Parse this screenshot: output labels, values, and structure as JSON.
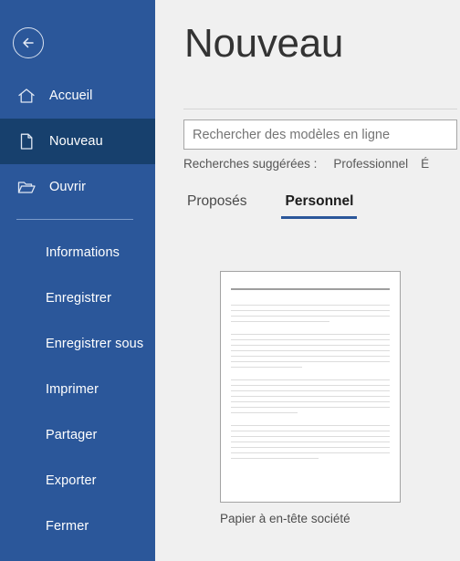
{
  "window": {
    "app": "Word",
    "accent_color": "#2b579a",
    "selected_color": "#17406d",
    "background_color": "#f0f0f0"
  },
  "sidebar": {
    "back_button": {
      "icon": "back-arrow-circle-icon",
      "label": "Retour"
    },
    "primary_items": [
      {
        "label": "Accueil",
        "icon": "home-icon",
        "selected": false
      },
      {
        "label": "Nouveau",
        "icon": "new-document-icon",
        "selected": true
      },
      {
        "label": "Ouvrir",
        "icon": "open-folder-icon",
        "selected": false
      }
    ],
    "secondary_items": [
      {
        "label": "Informations"
      },
      {
        "label": "Enregistrer"
      },
      {
        "label": "Enregistrer sous"
      },
      {
        "label": "Imprimer"
      },
      {
        "label": "Partager"
      },
      {
        "label": "Exporter"
      },
      {
        "label": "Fermer"
      }
    ]
  },
  "main": {
    "title": "Nouveau",
    "search": {
      "placeholder": "Rechercher des modèles en ligne",
      "value": ""
    },
    "suggested": {
      "label": "Recherches suggérées :",
      "links": [
        "Professionnel",
        "É"
      ]
    },
    "tabs": [
      {
        "label": "Proposés",
        "active": false
      },
      {
        "label": "Personnel",
        "active": true
      }
    ],
    "templates": [
      {
        "caption": "Papier à en-tête société"
      }
    ]
  }
}
